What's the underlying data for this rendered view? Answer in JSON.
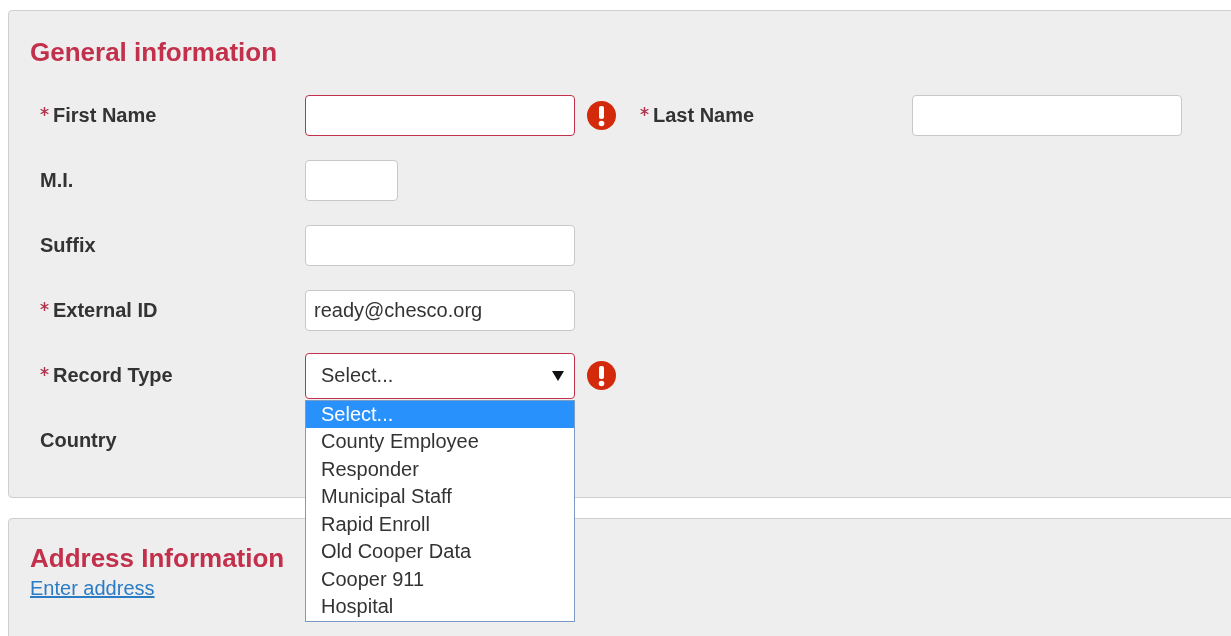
{
  "sections": [
    {
      "title": "General information",
      "rows": [
        {
          "fields": [
            {
              "label": "First Name",
              "required": true,
              "kind": "text",
              "error": true
            },
            {
              "label": "Last Name",
              "required": true,
              "kind": "text",
              "error": false
            }
          ]
        },
        {
          "fields": [
            {
              "label": "M.I.",
              "required": false,
              "kind": "short",
              "error": false
            }
          ]
        },
        {
          "fields": [
            {
              "label": "Suffix",
              "required": false,
              "kind": "text",
              "error": false
            }
          ]
        },
        {
          "fields": [
            {
              "label": "External ID",
              "required": true,
              "kind": "text",
              "value": "ready@chesco.org",
              "error": false
            }
          ]
        },
        {
          "fields": [
            {
              "label": "Record Type",
              "required": true,
              "kind": "select",
              "value": "Select...",
              "error": true,
              "expanded": true,
              "options": [
                {
                  "label": "Select...",
                  "selected": true
                },
                {
                  "label": "County Employee",
                  "selected": false
                },
                {
                  "label": "Responder",
                  "selected": false
                },
                {
                  "label": "Municipal Staff",
                  "selected": false
                },
                {
                  "label": "Rapid Enroll",
                  "selected": false
                },
                {
                  "label": "Old Cooper Data",
                  "selected": false
                },
                {
                  "label": "Cooper 911",
                  "selected": false
                },
                {
                  "label": "Hospital",
                  "selected": false
                }
              ]
            }
          ]
        },
        {
          "fields": [
            {
              "label": "Country",
              "kind": "hidden"
            }
          ]
        }
      ]
    },
    {
      "title": "Address Information",
      "link": "Enter address"
    }
  ]
}
